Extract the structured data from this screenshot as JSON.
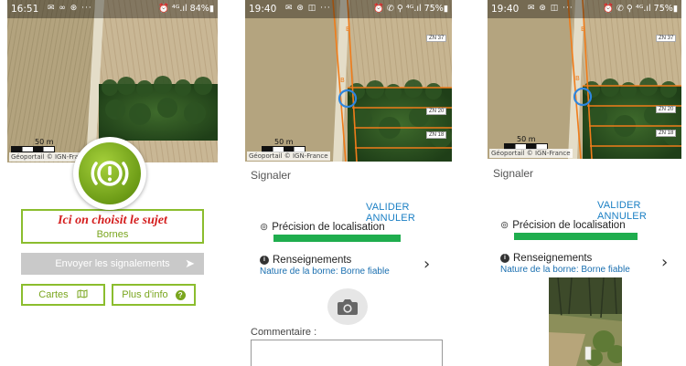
{
  "screens": [
    {
      "status": {
        "time": "16:51",
        "icons": "✉ ∞ ⊛ ···",
        "right": "⏰ ⁴ᴳ.ıl 84%▮"
      },
      "map": {
        "scale": "50 m",
        "attribution": "Géoportail © IGN-France"
      },
      "subject": {
        "title": "Ici on choisit le sujet",
        "value": "Bornes"
      },
      "send_label": "Envoyer les signalements",
      "cartes_label": "Cartes",
      "info_label": "Plus d'info"
    },
    {
      "status": {
        "time": "19:40",
        "icons": "✉ ⊛ ◫ ···",
        "right": "⏰ ✆ ⚲ ⁴ᴳ.ıl 75%▮"
      },
      "map": {
        "scale": "50 m",
        "attribution": "Géoportail © IGN-France",
        "parcels": [
          "ZN 37",
          "ZN 20",
          "ZN 18"
        ]
      },
      "form_title": "Signaler",
      "validate_label": "VALIDER",
      "cancel_label": "ANNULER",
      "precision_label": "Précision de localisation",
      "info_section_label": "Renseignements",
      "nature_value": "Nature de la borne: Borne fiable",
      "comment_label": "Commentaire :"
    },
    {
      "status": {
        "time": "19:40",
        "icons": "✉ ⊛ ◫ ···",
        "right": "⏰ ✆ ⚲ ⁴ᴳ.ıl 75%▮"
      },
      "map": {
        "scale": "50 m",
        "attribution": "Géoportail © IGN-France",
        "parcels": [
          "ZN 37",
          "ZN 20",
          "ZN 18"
        ]
      },
      "form_title": "Signaler",
      "validate_label": "VALIDER",
      "cancel_label": "ANNULER",
      "precision_label": "Précision de localisation",
      "info_section_label": "Renseignements",
      "nature_value": "Nature de la borne: Borne fiable"
    }
  ],
  "colors": {
    "accent_green": "#8bbd2e",
    "subject_red": "#d41d1d",
    "link_blue": "#1a7fc4",
    "precision_bar": "#1fad4e",
    "disabled_gray": "#c9c9c9"
  },
  "icons": [
    "brake-warning-icon",
    "send-icon",
    "map-icon",
    "info-icon",
    "location-pin-icon",
    "chevron-right-icon",
    "camera-icon"
  ]
}
